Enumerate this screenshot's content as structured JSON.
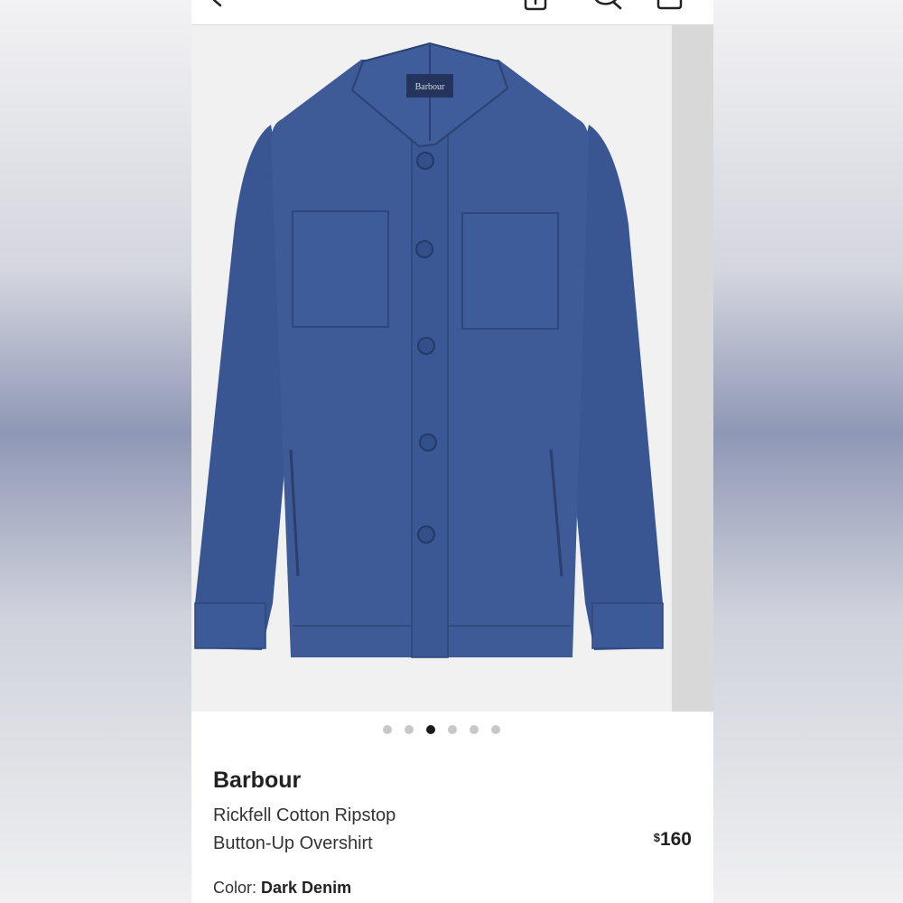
{
  "header": {
    "icons": [
      "back-arrow-icon",
      "share-icon",
      "search-icon",
      "bag-icon"
    ]
  },
  "gallery": {
    "image": "blue button-up overshirt product photo",
    "dots_total": 6,
    "active_dot_index": 2,
    "label_tag": "Barbour"
  },
  "product": {
    "brand": "Barbour",
    "name_line1": "Rickfell Cotton Ripstop",
    "name_line2": "Button-Up Overshirt",
    "currency": "$",
    "price": "160",
    "color_label": "Color:",
    "color_value": "Dark Denim"
  },
  "colors": {
    "shirt": "#3e5a97",
    "shirt_dark": "#2f477c",
    "active_dot": "#1b1b1b",
    "inactive_dot": "#c8c8c8"
  }
}
